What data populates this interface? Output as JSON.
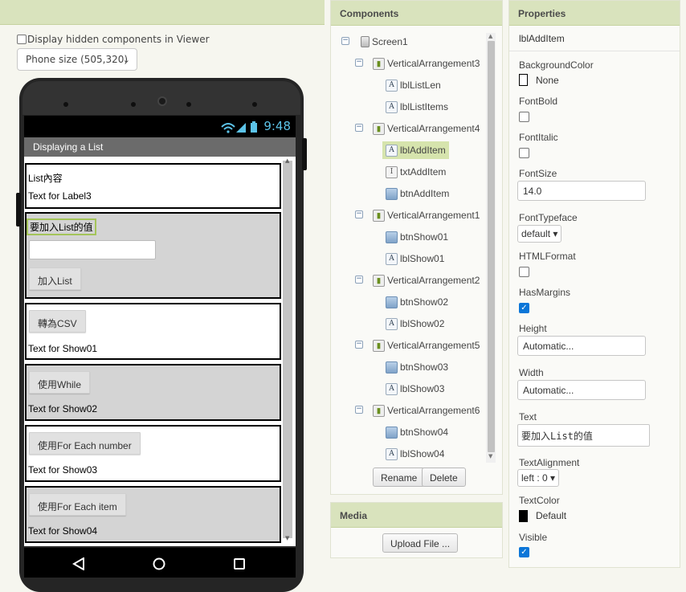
{
  "viewer": {
    "display_hidden_label": "Display hidden components in Viewer",
    "phone_size_value": "Phone size (505,320)",
    "phone": {
      "time": "9:48",
      "app_title": "Displaying a List",
      "arrangements": [
        {
          "label": "List內容",
          "text": "Text for Label3"
        },
        {
          "label": "要加入List的值",
          "button": "加入List"
        },
        {
          "button": "轉為CSV",
          "text": "Text for Show01"
        },
        {
          "button": "使用While",
          "text": "Text for Show02"
        },
        {
          "button": "使用For Each number",
          "text": "Text for Show03"
        },
        {
          "button": "使用For Each item",
          "text": "Text for Show04"
        }
      ]
    }
  },
  "components": {
    "title": "Components",
    "tree": [
      {
        "name": "Screen1",
        "type": "screen"
      },
      {
        "name": "VerticalArrangement3",
        "type": "arrangement"
      },
      {
        "name": "lblListLen",
        "type": "label"
      },
      {
        "name": "lblListItems",
        "type": "label"
      },
      {
        "name": "VerticalArrangement4",
        "type": "arrangement"
      },
      {
        "name": "lblAddItem",
        "type": "label",
        "selected": true
      },
      {
        "name": "txtAddItem",
        "type": "textbox"
      },
      {
        "name": "btnAddItem",
        "type": "button"
      },
      {
        "name": "VerticalArrangement1",
        "type": "arrangement"
      },
      {
        "name": "btnShow01",
        "type": "button"
      },
      {
        "name": "lblShow01",
        "type": "label"
      },
      {
        "name": "VerticalArrangement2",
        "type": "arrangement"
      },
      {
        "name": "btnShow02",
        "type": "button"
      },
      {
        "name": "lblShow02",
        "type": "label"
      },
      {
        "name": "VerticalArrangement5",
        "type": "arrangement"
      },
      {
        "name": "btnShow03",
        "type": "button"
      },
      {
        "name": "lblShow03",
        "type": "label"
      },
      {
        "name": "VerticalArrangement6",
        "type": "arrangement"
      },
      {
        "name": "btnShow04",
        "type": "button"
      },
      {
        "name": "lblShow04",
        "type": "label"
      }
    ],
    "rename_label": "Rename",
    "delete_label": "Delete"
  },
  "media": {
    "title": "Media",
    "upload_label": "Upload File ..."
  },
  "properties": {
    "title": "Properties",
    "component_name": "lblAddItem",
    "background_color": {
      "label": "BackgroundColor",
      "value": "None",
      "swatch": "#ffffff"
    },
    "font_bold": {
      "label": "FontBold",
      "checked": false
    },
    "font_italic": {
      "label": "FontItalic",
      "checked": false
    },
    "font_size": {
      "label": "FontSize",
      "value": "14.0"
    },
    "font_typeface": {
      "label": "FontTypeface",
      "value": "default ▾"
    },
    "html_format": {
      "label": "HTMLFormat",
      "checked": false
    },
    "has_margins": {
      "label": "HasMargins",
      "checked": true
    },
    "height": {
      "label": "Height",
      "value": "Automatic..."
    },
    "width": {
      "label": "Width",
      "value": "Automatic..."
    },
    "text": {
      "label": "Text",
      "value": "要加入List的值"
    },
    "text_alignment": {
      "label": "TextAlignment",
      "value": "left : 0 ▾"
    },
    "text_color": {
      "label": "TextColor",
      "value": "Default",
      "swatch": "#000000"
    },
    "visible": {
      "label": "Visible",
      "checked": true
    }
  },
  "colors": {
    "header_bg": "#d9e3bd",
    "selected_row": "#d6e4ad",
    "checkbox_on": "#0b76d8"
  }
}
